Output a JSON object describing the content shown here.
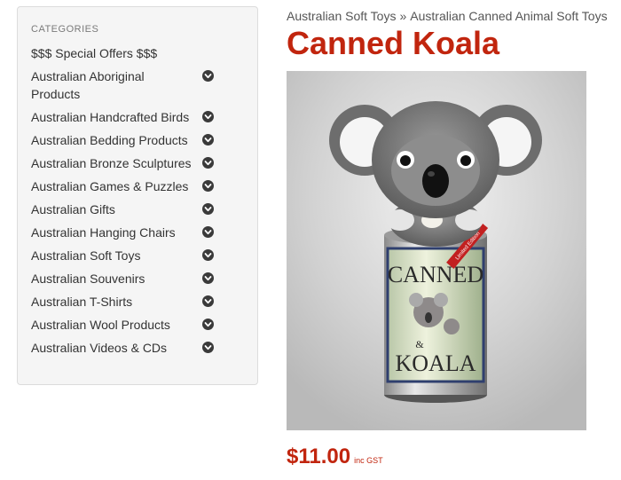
{
  "sidebar": {
    "heading": "CATEGORIES",
    "items": [
      {
        "label": "$$$ Special Offers $$$",
        "has_submenu": false
      },
      {
        "label": "Australian Aboriginal Products",
        "has_submenu": true
      },
      {
        "label": "Australian Handcrafted Birds",
        "has_submenu": true
      },
      {
        "label": "Australian Bedding Products",
        "has_submenu": true
      },
      {
        "label": "Australian Bronze Sculptures",
        "has_submenu": true
      },
      {
        "label": "Australian Games & Puzzles",
        "has_submenu": true
      },
      {
        "label": "Australian Gifts",
        "has_submenu": true
      },
      {
        "label": "Australian Hanging Chairs",
        "has_submenu": true
      },
      {
        "label": "Australian Soft Toys",
        "has_submenu": true
      },
      {
        "label": "Australian Souvenirs",
        "has_submenu": true
      },
      {
        "label": "Australian T-Shirts",
        "has_submenu": true
      },
      {
        "label": "Australian Wool Products",
        "has_submenu": true
      },
      {
        "label": "Australian Videos & CDs",
        "has_submenu": true
      }
    ]
  },
  "breadcrumb": {
    "items": [
      "Australian Soft Toys",
      "Australian Canned Animal Soft Toys"
    ],
    "separator": "»"
  },
  "product": {
    "title": "Canned Koala",
    "price": "$11.00",
    "tax_note": "inc GST",
    "image": {
      "can_text_top": "CANNED",
      "can_text_amp": "&",
      "can_text_bottom": "KOALA",
      "ribbon_text": "Limited Edition"
    }
  },
  "colors": {
    "title": "#c1250e",
    "price": "#c1250e",
    "sidebar_bg": "#f5f5f5",
    "icon": "#3a3a3a"
  },
  "icons": {
    "submenu": "chevron-circle-down-icon"
  }
}
